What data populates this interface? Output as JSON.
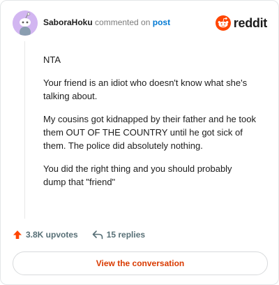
{
  "header": {
    "username": "SaboraHoku",
    "action": "commented on",
    "post_link": "post",
    "brand": "reddit"
  },
  "comment": {
    "paragraphs": [
      "NTA",
      "Your friend is an idiot who doesn't know what she's talking about.",
      "My cousins got kidnapped by their father and he took them OUT OF THE COUNTRY until he got sick of them. The police did absolutely nothing.",
      "You did the right thing and you should probably dump that \"friend\""
    ]
  },
  "footer": {
    "upvotes": "3.8K upvotes",
    "replies": "15 replies"
  },
  "cta": {
    "label": "View the conversation"
  },
  "colors": {
    "avatar_bg": "#d2b6f1",
    "brand_orange": "#ff4500",
    "link_blue": "#0079d3",
    "cta_text": "#d93a00"
  },
  "icons": {
    "avatar": "snoo-avatar-icon",
    "brand": "reddit-logo-icon",
    "upvote": "upvote-arrow-icon",
    "reply": "reply-arrow-icon"
  }
}
